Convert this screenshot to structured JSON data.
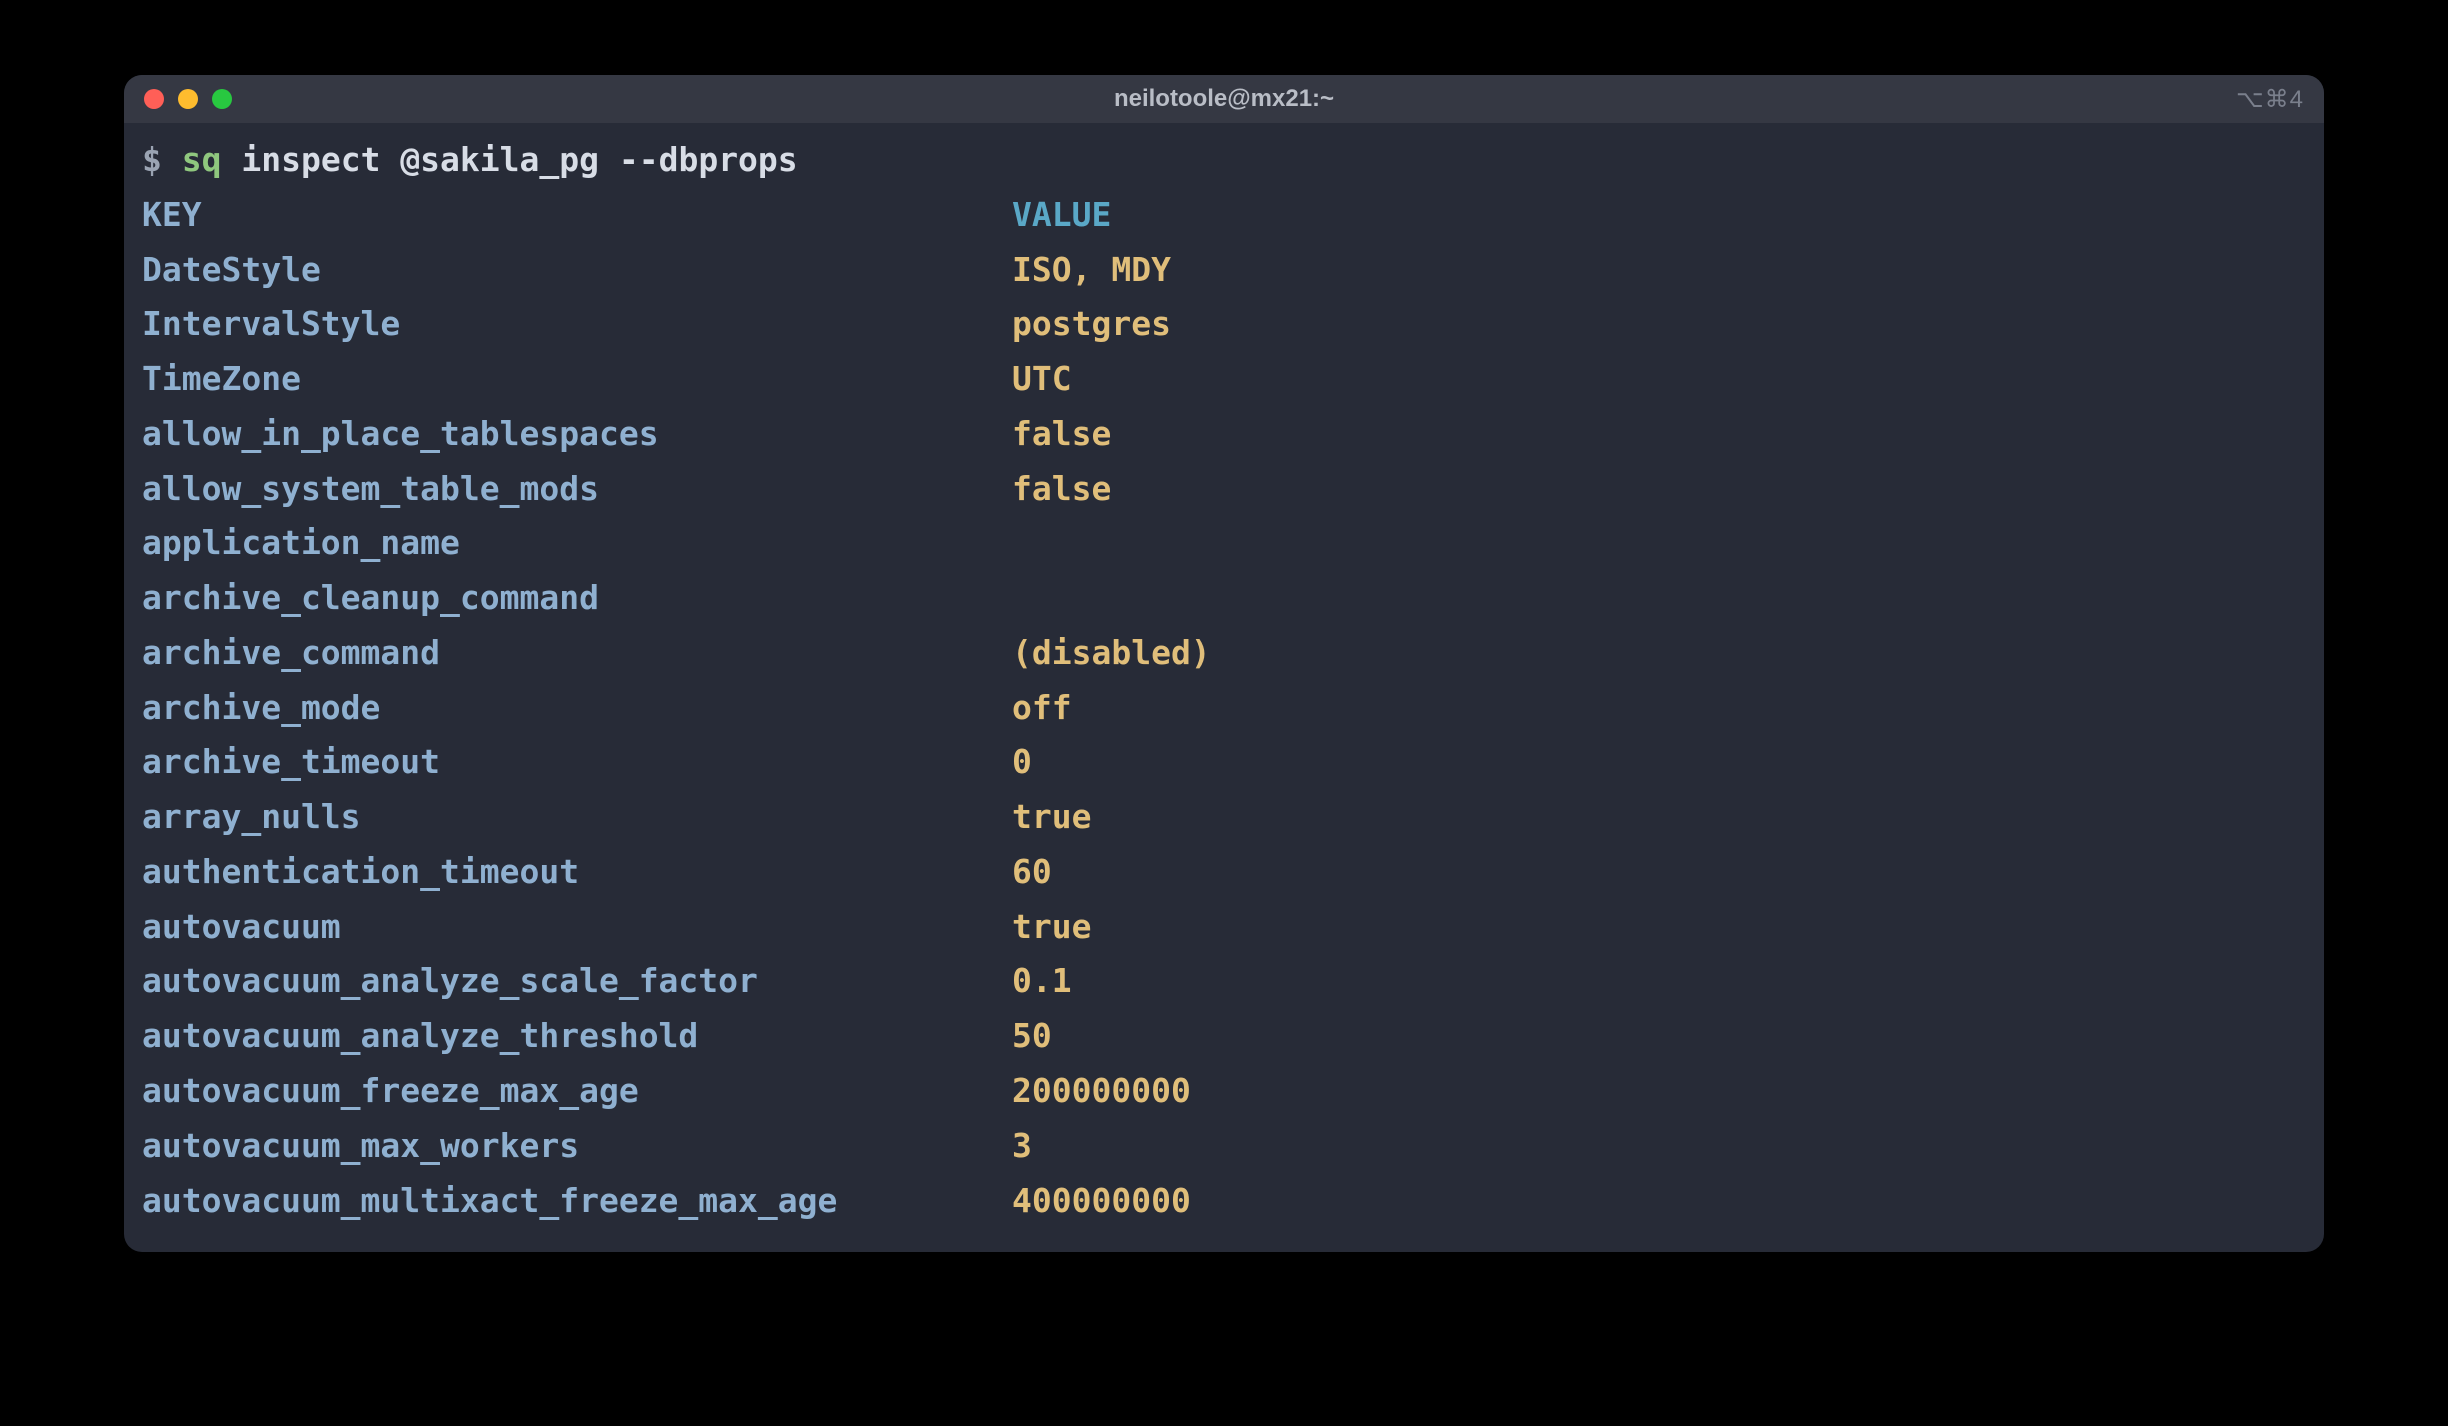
{
  "window": {
    "title": "neilotoole@mx21:~",
    "shortcut": "⌥⌘4"
  },
  "prompt": {
    "symbol": "$ ",
    "cmd": "sq",
    "args": " inspect @sakila_pg --dbprops"
  },
  "headers": {
    "key": "KEY",
    "value": "VALUE"
  },
  "rows": [
    {
      "key": "DateStyle",
      "value": "ISO, MDY"
    },
    {
      "key": "IntervalStyle",
      "value": "postgres"
    },
    {
      "key": "TimeZone",
      "value": "UTC"
    },
    {
      "key": "allow_in_place_tablespaces",
      "value": "false"
    },
    {
      "key": "allow_system_table_mods",
      "value": "false"
    },
    {
      "key": "application_name",
      "value": ""
    },
    {
      "key": "archive_cleanup_command",
      "value": ""
    },
    {
      "key": "archive_command",
      "value": "(disabled)"
    },
    {
      "key": "archive_mode",
      "value": "off"
    },
    {
      "key": "archive_timeout",
      "value": "0"
    },
    {
      "key": "array_nulls",
      "value": "true"
    },
    {
      "key": "authentication_timeout",
      "value": "60"
    },
    {
      "key": "autovacuum",
      "value": "true"
    },
    {
      "key": "autovacuum_analyze_scale_factor",
      "value": "0.1"
    },
    {
      "key": "autovacuum_analyze_threshold",
      "value": "50"
    },
    {
      "key": "autovacuum_freeze_max_age",
      "value": "200000000"
    },
    {
      "key": "autovacuum_max_workers",
      "value": "3"
    },
    {
      "key": "autovacuum_multixact_freeze_max_age",
      "value": "400000000"
    }
  ]
}
